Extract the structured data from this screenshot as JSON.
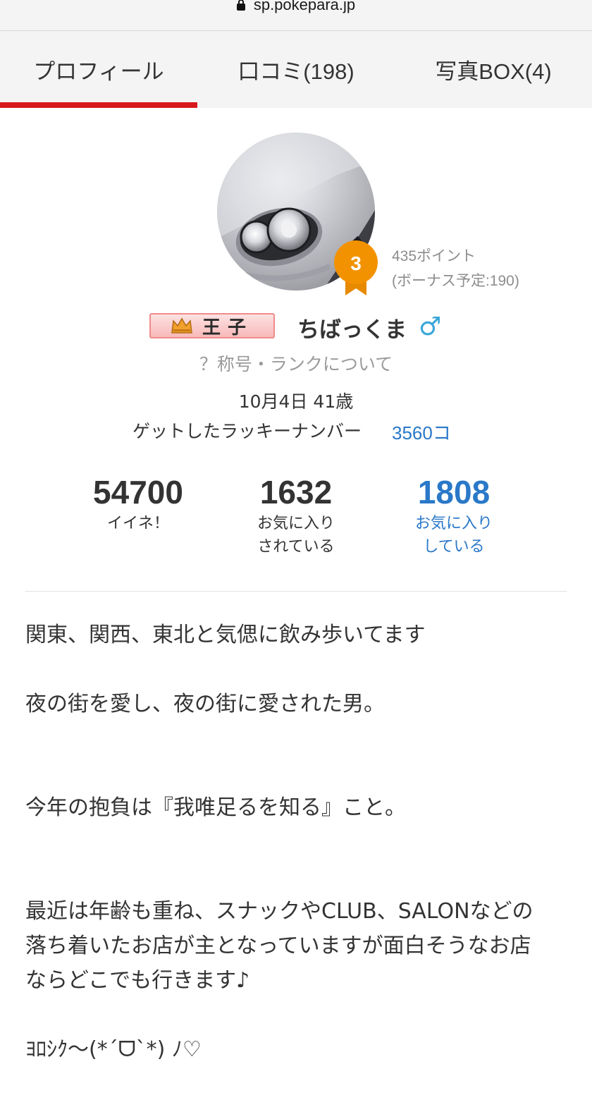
{
  "browser": {
    "url": "sp.pokepara.jp"
  },
  "tabs": [
    {
      "label": "プロフィール",
      "active": true
    },
    {
      "label": "口コミ(198)",
      "active": false
    },
    {
      "label": "写真BOX(4)",
      "active": false
    }
  ],
  "profile": {
    "rank_level": "3",
    "points": "435ポイント",
    "bonus": "(ボーナス予定:190)",
    "title_badge": "王子",
    "username": "ちばっくま",
    "gender_symbol": "♂",
    "rank_info_link": "？称号・ランクについて",
    "birthday_age": "10月4日 41歳",
    "lucky_label": "ゲットしたラッキーナンバー",
    "lucky_value": "3560コ"
  },
  "stats": [
    {
      "value": "54700",
      "label_line1": "イイネ！",
      "label_line2": ""
    },
    {
      "value": "1632",
      "label_line1": "お気に入り",
      "label_line2": "されている"
    },
    {
      "value": "1808",
      "label_line1": "お気に入り",
      "label_line2": "している"
    }
  ],
  "bio": {
    "line1": "関東、関西、東北と気偲に飲み歩いてます",
    "line2": "夜の街を愛し、夜の街に愛された男。",
    "line3": "今年の抱負は『我唯足るを知る』こと。",
    "line4": "最近は年齢も重ね、スナックやCLUB、SALONなどの",
    "line5": "落ち着いたお店が主となっていますが面白そうなお店",
    "line6": "ならどこでも行きます♪",
    "line7": "ﾖﾛｼｸ～(*´ᗜ`*) ﾉ♡"
  },
  "colors": {
    "accent_red": "#d7191c",
    "link_blue": "#2a78c8",
    "badge_orange": "#f39200",
    "male_blue": "#3aa6d8"
  }
}
